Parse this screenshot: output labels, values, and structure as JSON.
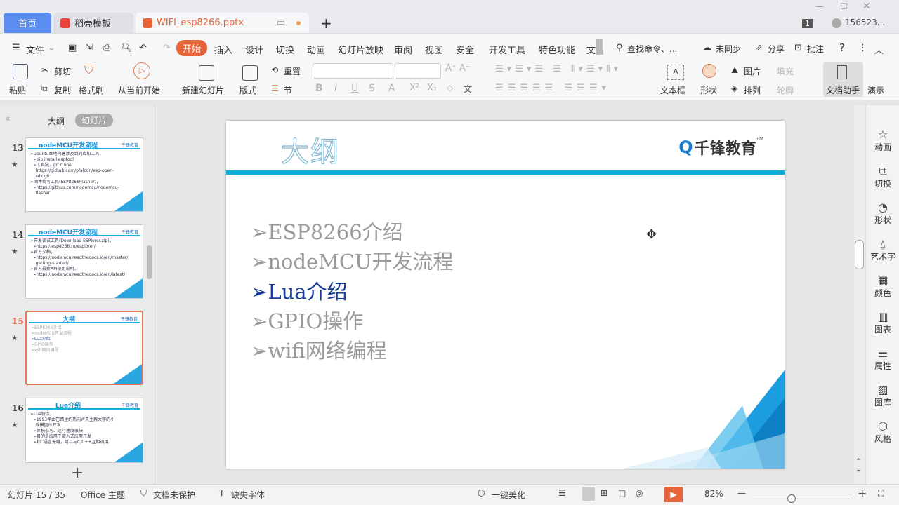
{
  "tabs": {
    "home": "首页",
    "template": "稻壳模板",
    "file": "WIFI_esp8266.pptx",
    "new_tab": "+"
  },
  "window": {
    "badge": "1",
    "user": "156523..."
  },
  "menu": {
    "file": "文件",
    "items": [
      "开始",
      "插入",
      "设计",
      "切换",
      "动画",
      "幻灯片放映",
      "审阅",
      "视图",
      "安全",
      "开发工具",
      "特色功能",
      "文"
    ],
    "search": "查找命令、...",
    "sync": "未同步",
    "share": "分享",
    "comment": "批注",
    "help": "?"
  },
  "ribbon": {
    "paste": "粘贴",
    "cut": "剪切",
    "copy": "复制",
    "format_painter": "格式刷",
    "play_from_current": "从当前开始",
    "new_slide": "新建幻灯片",
    "layout": "版式",
    "reset": "重置",
    "section": "节",
    "textbox": "文本框",
    "shape": "形状",
    "picture": "图片",
    "fill": "填充",
    "arrange": "排列",
    "outline": "轮廓",
    "doc_assistant": "文档助手",
    "present": "演示",
    "bold": "B",
    "italic": "I",
    "underline": "U",
    "strike": "S",
    "wen": "文"
  },
  "left_panel": {
    "tab_outline": "大纲",
    "tab_slides": "幻灯片",
    "add": "+",
    "thumbs": [
      {
        "num": "13",
        "title": "nodeMCU开发流程",
        "lines": [
          "➢ubuntu本地构建涉及到的库和工具，",
          "  ➢pip install esptool",
          "  ➢工具链，git clone",
          "    https://github.com/pfalcon/esp-open-",
          "    sdk.git",
          "➢固件烧写工具(ESP8266Flasher)，",
          "  ➢https://github.com/nodemcu/nodemcu-",
          "    flasher"
        ]
      },
      {
        "num": "14",
        "title": "nodeMCU开发流程",
        "lines": [
          "➢开发调试工具(Download ESPlorer.zip)，",
          "  ➢https://esp8266.ru/esplorer/",
          "➢官方文档，",
          "  ➢https://nodemcu.readthedocs.io/en/master/",
          "    getting-started/",
          "➢官方最新API使用说明，",
          "  ➢https://nodemcu.readthedocs.io/en/latest/"
        ]
      },
      {
        "num": "15",
        "title": "大纲",
        "lines": [
          "➢ESP8266介绍",
          "➢nodeMCU开发流程",
          "➢Lua介绍",
          "➢GPIO操作",
          "➢wifi网络编程"
        ]
      },
      {
        "num": "16",
        "title": "Lua介绍",
        "lines": [
          "➢Lua特点，",
          "  ➢1993年由巴西里约热内卢天主教大学的小",
          "    规模团体开发",
          "  ➢体积小巧、运行速度很快",
          "  ➢目的是应用于嵌入式应用开发",
          "  ➢和C语言无缝，可以与C/C++互相调用"
        ]
      }
    ]
  },
  "slide": {
    "title": "大纲",
    "logo": "千锋教育",
    "tm": "TM",
    "bullet": "➢",
    "items": [
      {
        "text": "ESP8266介绍",
        "active": false
      },
      {
        "text": "nodeMCU开发流程",
        "active": false
      },
      {
        "text": "Lua介绍",
        "active": true
      },
      {
        "text": "GPIO操作",
        "active": false
      },
      {
        "text": "wifi网络编程",
        "active": false
      }
    ]
  },
  "right_bar": [
    {
      "icon": "star-icon",
      "label": "动画"
    },
    {
      "icon": "switch-icon",
      "label": "切换"
    },
    {
      "icon": "shape-icon",
      "label": "形状"
    },
    {
      "icon": "wordart-icon",
      "label": "艺术字"
    },
    {
      "icon": "color-icon",
      "label": "颜色"
    },
    {
      "icon": "chart-icon",
      "label": "图表"
    },
    {
      "icon": "properties-icon",
      "label": "属性"
    },
    {
      "icon": "gallery-icon",
      "label": "图库"
    },
    {
      "icon": "style-icon",
      "label": "风格"
    }
  ],
  "status": {
    "slide": "幻灯片 15 / 35",
    "theme": "Office 主题",
    "protect": "文档未保护",
    "font": "缺失字体",
    "beautify": "一键美化",
    "zoom": "82%"
  },
  "colors": {
    "accent": "#e8643b",
    "home_tab": "#5b8def",
    "slide_bar": "#12a9dd",
    "active_item": "#163c97"
  }
}
